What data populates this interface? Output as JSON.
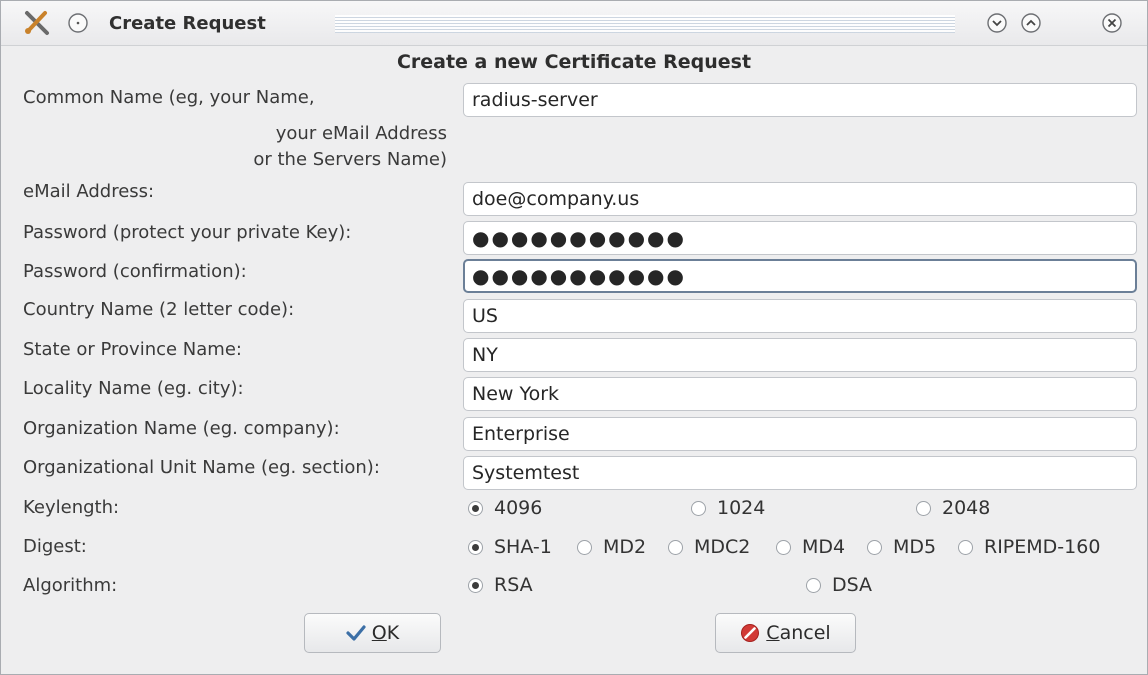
{
  "window": {
    "title": "Create Request"
  },
  "heading": "Create a new Certificate Request",
  "labels": {
    "common_name_1": "Common Name (eg, your Name,",
    "common_name_2": "your eMail Address",
    "common_name_3": "or the Servers Name)",
    "email": "eMail Address:",
    "password": "Password (protect your private Key):",
    "password_confirm": "Password (confirmation):",
    "country": "Country Name (2 letter code):",
    "state": "State or Province Name:",
    "locality": "Locality Name (eg. city):",
    "organization": "Organization Name (eg. company):",
    "org_unit": "Organizational Unit Name (eg. section):",
    "keylength": "Keylength:",
    "digest": "Digest:",
    "algorithm": "Algorithm:"
  },
  "fields": {
    "common_name": "radius-server",
    "email": "doe@company.us",
    "password": "●●●●●●●●●●●",
    "password_confirm": "●●●●●●●●●●●",
    "country": "US",
    "state": "NY",
    "locality": "New York",
    "organization": "Enterprise",
    "org_unit": "Systemtest"
  },
  "keylength": {
    "options": [
      "4096",
      "1024",
      "2048"
    ],
    "selected": "4096"
  },
  "digest": {
    "options": [
      "SHA-1",
      "MD2",
      "MDC2",
      "MD4",
      "MD5",
      "RIPEMD-160"
    ],
    "selected": "SHA-1"
  },
  "algorithm": {
    "options": [
      "RSA",
      "DSA"
    ],
    "selected": "RSA"
  },
  "buttons": {
    "ok_mnemonic": "O",
    "ok_rest": "K",
    "cancel_mnemonic": "C",
    "cancel_rest": "ancel"
  },
  "icons": {
    "app": "tools-icon",
    "menu": "window-menu-icon",
    "minimize": "chevron-down-icon",
    "maximize": "chevron-up-icon",
    "close": "close-icon",
    "ok": "checkmark-icon",
    "cancel": "cancel-icon"
  }
}
